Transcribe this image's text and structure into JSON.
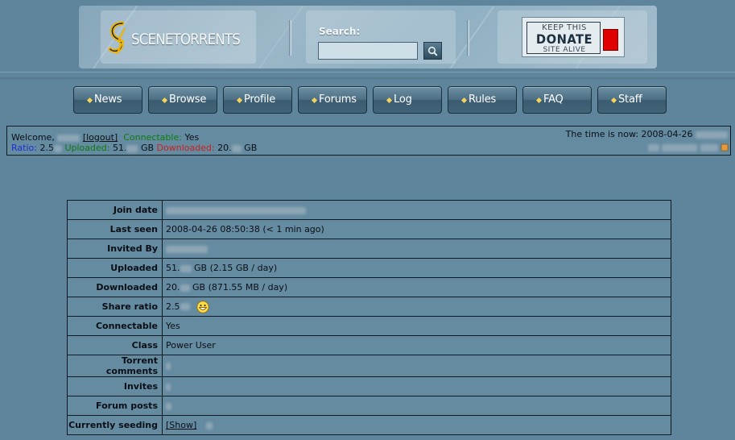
{
  "header": {
    "logo_text": "SCENETORRENTS",
    "search_label": "Search:",
    "search_value": "",
    "donate": {
      "top": "KEEP THIS",
      "middle": "DONATE",
      "bottom": "SITE ALIVE"
    }
  },
  "nav": [
    {
      "label": "News"
    },
    {
      "label": "Browse"
    },
    {
      "label": "Profile"
    },
    {
      "label": "Forums"
    },
    {
      "label": "Log"
    },
    {
      "label": "Rules"
    },
    {
      "label": "FAQ"
    },
    {
      "label": "Staff"
    }
  ],
  "status": {
    "welcome_label": "Welcome,",
    "logout_label": "[logout]",
    "connectable_label": "Connectable:",
    "connectable_value": "Yes",
    "ratio_label": "Ratio:",
    "ratio_value": "2.5",
    "uploaded_label": "Uploaded:",
    "uploaded_value": "51.",
    "uploaded_unit": "GB",
    "downloaded_label": "Downloaded:",
    "downloaded_value": "20.",
    "downloaded_unit": "GB",
    "time_label": "The time is now: 2008-04-26"
  },
  "profile": {
    "join_date_label": "Join date",
    "last_seen_label": "Last seen",
    "last_seen_value": "2008-04-26 08:50:38 (< 1 min ago)",
    "invited_by_label": "Invited By",
    "uploaded_label": "Uploaded",
    "uploaded_value": "51.",
    "uploaded_rest": "GB (2.15 GB / day)",
    "downloaded_label": "Downloaded",
    "downloaded_value": "20.",
    "downloaded_rest": "GB (871.55 MB / day)",
    "share_ratio_label": "Share ratio",
    "share_ratio_value": "2.5",
    "connectable_label": "Connectable",
    "connectable_value": "Yes",
    "class_label": "Class",
    "class_value": "Power User",
    "torrent_comments_label": "Torrent comments",
    "invites_label": "Invites",
    "forum_posts_label": "Forum posts",
    "seeding_label": "Currently seeding",
    "seeding_link": "[Show]"
  },
  "icons": {
    "search": "magnifier-icon",
    "nav_bullet": "diamond-bullet-icon",
    "ratio_smiley": "grin-smiley-icon",
    "status_extras": "flag-icon"
  },
  "colors": {
    "page_bg": "#5f859c",
    "connectable": "#0e7a0e",
    "ratio": "#1c2fd8",
    "downloaded": "#d21e1e",
    "donate_red": "#e00000"
  }
}
